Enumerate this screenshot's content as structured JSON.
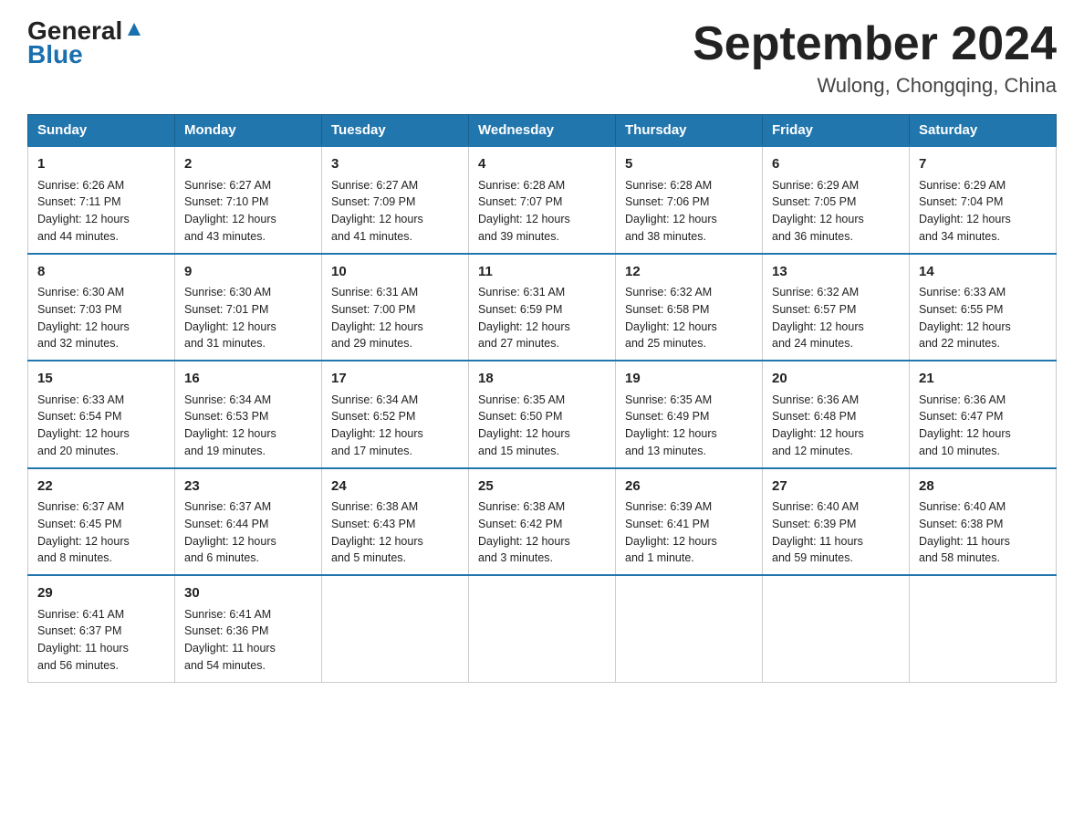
{
  "header": {
    "logo_general": "General",
    "logo_blue": "Blue",
    "month_title": "September 2024",
    "location": "Wulong, Chongqing, China"
  },
  "days_of_week": [
    "Sunday",
    "Monday",
    "Tuesday",
    "Wednesday",
    "Thursday",
    "Friday",
    "Saturday"
  ],
  "weeks": [
    [
      {
        "day": "1",
        "sunrise": "6:26 AM",
        "sunset": "7:11 PM",
        "daylight": "12 hours and 44 minutes."
      },
      {
        "day": "2",
        "sunrise": "6:27 AM",
        "sunset": "7:10 PM",
        "daylight": "12 hours and 43 minutes."
      },
      {
        "day": "3",
        "sunrise": "6:27 AM",
        "sunset": "7:09 PM",
        "daylight": "12 hours and 41 minutes."
      },
      {
        "day": "4",
        "sunrise": "6:28 AM",
        "sunset": "7:07 PM",
        "daylight": "12 hours and 39 minutes."
      },
      {
        "day": "5",
        "sunrise": "6:28 AM",
        "sunset": "7:06 PM",
        "daylight": "12 hours and 38 minutes."
      },
      {
        "day": "6",
        "sunrise": "6:29 AM",
        "sunset": "7:05 PM",
        "daylight": "12 hours and 36 minutes."
      },
      {
        "day": "7",
        "sunrise": "6:29 AM",
        "sunset": "7:04 PM",
        "daylight": "12 hours and 34 minutes."
      }
    ],
    [
      {
        "day": "8",
        "sunrise": "6:30 AM",
        "sunset": "7:03 PM",
        "daylight": "12 hours and 32 minutes."
      },
      {
        "day": "9",
        "sunrise": "6:30 AM",
        "sunset": "7:01 PM",
        "daylight": "12 hours and 31 minutes."
      },
      {
        "day": "10",
        "sunrise": "6:31 AM",
        "sunset": "7:00 PM",
        "daylight": "12 hours and 29 minutes."
      },
      {
        "day": "11",
        "sunrise": "6:31 AM",
        "sunset": "6:59 PM",
        "daylight": "12 hours and 27 minutes."
      },
      {
        "day": "12",
        "sunrise": "6:32 AM",
        "sunset": "6:58 PM",
        "daylight": "12 hours and 25 minutes."
      },
      {
        "day": "13",
        "sunrise": "6:32 AM",
        "sunset": "6:57 PM",
        "daylight": "12 hours and 24 minutes."
      },
      {
        "day": "14",
        "sunrise": "6:33 AM",
        "sunset": "6:55 PM",
        "daylight": "12 hours and 22 minutes."
      }
    ],
    [
      {
        "day": "15",
        "sunrise": "6:33 AM",
        "sunset": "6:54 PM",
        "daylight": "12 hours and 20 minutes."
      },
      {
        "day": "16",
        "sunrise": "6:34 AM",
        "sunset": "6:53 PM",
        "daylight": "12 hours and 19 minutes."
      },
      {
        "day": "17",
        "sunrise": "6:34 AM",
        "sunset": "6:52 PM",
        "daylight": "12 hours and 17 minutes."
      },
      {
        "day": "18",
        "sunrise": "6:35 AM",
        "sunset": "6:50 PM",
        "daylight": "12 hours and 15 minutes."
      },
      {
        "day": "19",
        "sunrise": "6:35 AM",
        "sunset": "6:49 PM",
        "daylight": "12 hours and 13 minutes."
      },
      {
        "day": "20",
        "sunrise": "6:36 AM",
        "sunset": "6:48 PM",
        "daylight": "12 hours and 12 minutes."
      },
      {
        "day": "21",
        "sunrise": "6:36 AM",
        "sunset": "6:47 PM",
        "daylight": "12 hours and 10 minutes."
      }
    ],
    [
      {
        "day": "22",
        "sunrise": "6:37 AM",
        "sunset": "6:45 PM",
        "daylight": "12 hours and 8 minutes."
      },
      {
        "day": "23",
        "sunrise": "6:37 AM",
        "sunset": "6:44 PM",
        "daylight": "12 hours and 6 minutes."
      },
      {
        "day": "24",
        "sunrise": "6:38 AM",
        "sunset": "6:43 PM",
        "daylight": "12 hours and 5 minutes."
      },
      {
        "day": "25",
        "sunrise": "6:38 AM",
        "sunset": "6:42 PM",
        "daylight": "12 hours and 3 minutes."
      },
      {
        "day": "26",
        "sunrise": "6:39 AM",
        "sunset": "6:41 PM",
        "daylight": "12 hours and 1 minute."
      },
      {
        "day": "27",
        "sunrise": "6:40 AM",
        "sunset": "6:39 PM",
        "daylight": "11 hours and 59 minutes."
      },
      {
        "day": "28",
        "sunrise": "6:40 AM",
        "sunset": "6:38 PM",
        "daylight": "11 hours and 58 minutes."
      }
    ],
    [
      {
        "day": "29",
        "sunrise": "6:41 AM",
        "sunset": "6:37 PM",
        "daylight": "11 hours and 56 minutes."
      },
      {
        "day": "30",
        "sunrise": "6:41 AM",
        "sunset": "6:36 PM",
        "daylight": "11 hours and 54 minutes."
      },
      null,
      null,
      null,
      null,
      null
    ]
  ],
  "sunrise_label": "Sunrise:",
  "sunset_label": "Sunset:",
  "daylight_label": "Daylight:"
}
